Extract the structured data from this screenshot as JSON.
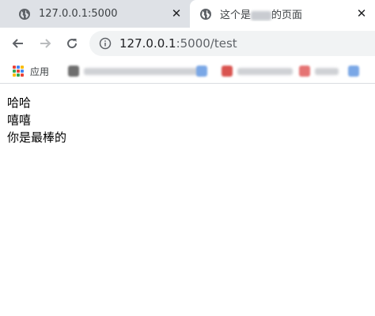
{
  "tabs": [
    {
      "title": "127.0.0.1:5000",
      "active": false
    },
    {
      "title_prefix": "这个是",
      "title_suffix": "的页面",
      "active": true
    }
  ],
  "toolbar": {
    "url_host": "127.0.0.1",
    "url_port_path": ":5000/test"
  },
  "bookmarks": {
    "apps_label": "应用"
  },
  "content": {
    "lines": [
      "哈哈",
      "嘻嘻",
      "你是最棒的"
    ]
  },
  "colors": {
    "tabstrip": "#dee1e6",
    "omnibox": "#f1f3f4",
    "text": "#000000"
  }
}
